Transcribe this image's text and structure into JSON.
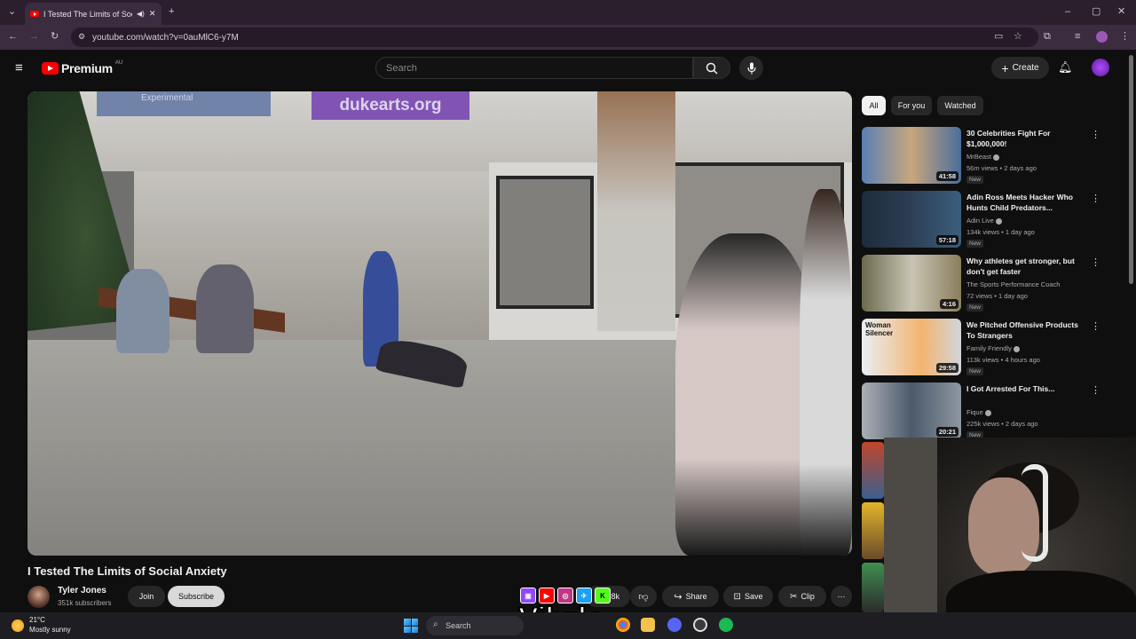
{
  "browser": {
    "tab_title": "I Tested The Limits of Social",
    "url": "youtube.com/watch?v=0auMlC6-y7M"
  },
  "header": {
    "logo": "Premium",
    "region": "AU",
    "search_placeholder": "Search",
    "create_label": "Create"
  },
  "player": {
    "banner_main": "dukearts.org",
    "banner_left": "Experimental"
  },
  "video": {
    "title": "I Tested The Limits of Social Anxiety",
    "channel": "Tyler Jones",
    "subscribers": "351k subscribers",
    "join_label": "Join",
    "subscribe_label": "Subscribe",
    "like_count": "8k",
    "share_label": "Share",
    "save_label": "Save",
    "clip_label": "Clip"
  },
  "chips": [
    "All",
    "For you",
    "Watched"
  ],
  "recommendations": [
    {
      "title": "30 Celebrities Fight For $1,000,000!",
      "channel": "MrBeast",
      "meta": "56m views • 2 days ago",
      "badge": "New",
      "duration": "41:58",
      "thumb_colors": [
        "#5a7fb4",
        "#c7a77d"
      ]
    },
    {
      "title": "Adin Ross Meets Hacker Who Hunts Child Predators...",
      "channel": "Adin Live",
      "meta": "134k views • 1 day ago",
      "badge": "New",
      "duration": "57:18",
      "thumb_colors": [
        "#1d2b3c",
        "#3b5e7d"
      ]
    },
    {
      "title": "Why athletes get stronger, but don't get faster",
      "channel": "The Sports Performance Coach",
      "meta": "72 views • 1 day ago",
      "badge": "New",
      "duration": "4:16",
      "thumb_colors": [
        "#6b6a4e",
        "#c9c4b4"
      ]
    },
    {
      "title": "We Pitched Offensive Products To Strangers",
      "channel": "Family Friendly",
      "meta": "113k views • 4 hours ago",
      "badge": "New",
      "duration": "29:58",
      "thumb_colors": [
        "#e9eef5",
        "#f3b56e"
      ],
      "thumb_text": "Woman Silencer"
    },
    {
      "title": "I Got Arrested For This...",
      "channel": "Fique",
      "meta": "225k views • 2 days ago",
      "badge": "New",
      "duration": "20:21",
      "thumb_colors": [
        "#aab0b6",
        "#4c5a6c"
      ]
    }
  ],
  "overlay": {
    "watermark": "Vibzlo",
    "social_icons": [
      "twitch-icon",
      "youtube-icon",
      "instagram-icon",
      "twitter-icon",
      "kick-icon"
    ]
  },
  "taskbar": {
    "temperature": "21°C",
    "weather": "Mostly sunny",
    "search_label": "Search"
  },
  "colors": {
    "accent": "#ff0000",
    "background": "#0f0f0f",
    "chrome_frame": "#2b1f2e"
  }
}
